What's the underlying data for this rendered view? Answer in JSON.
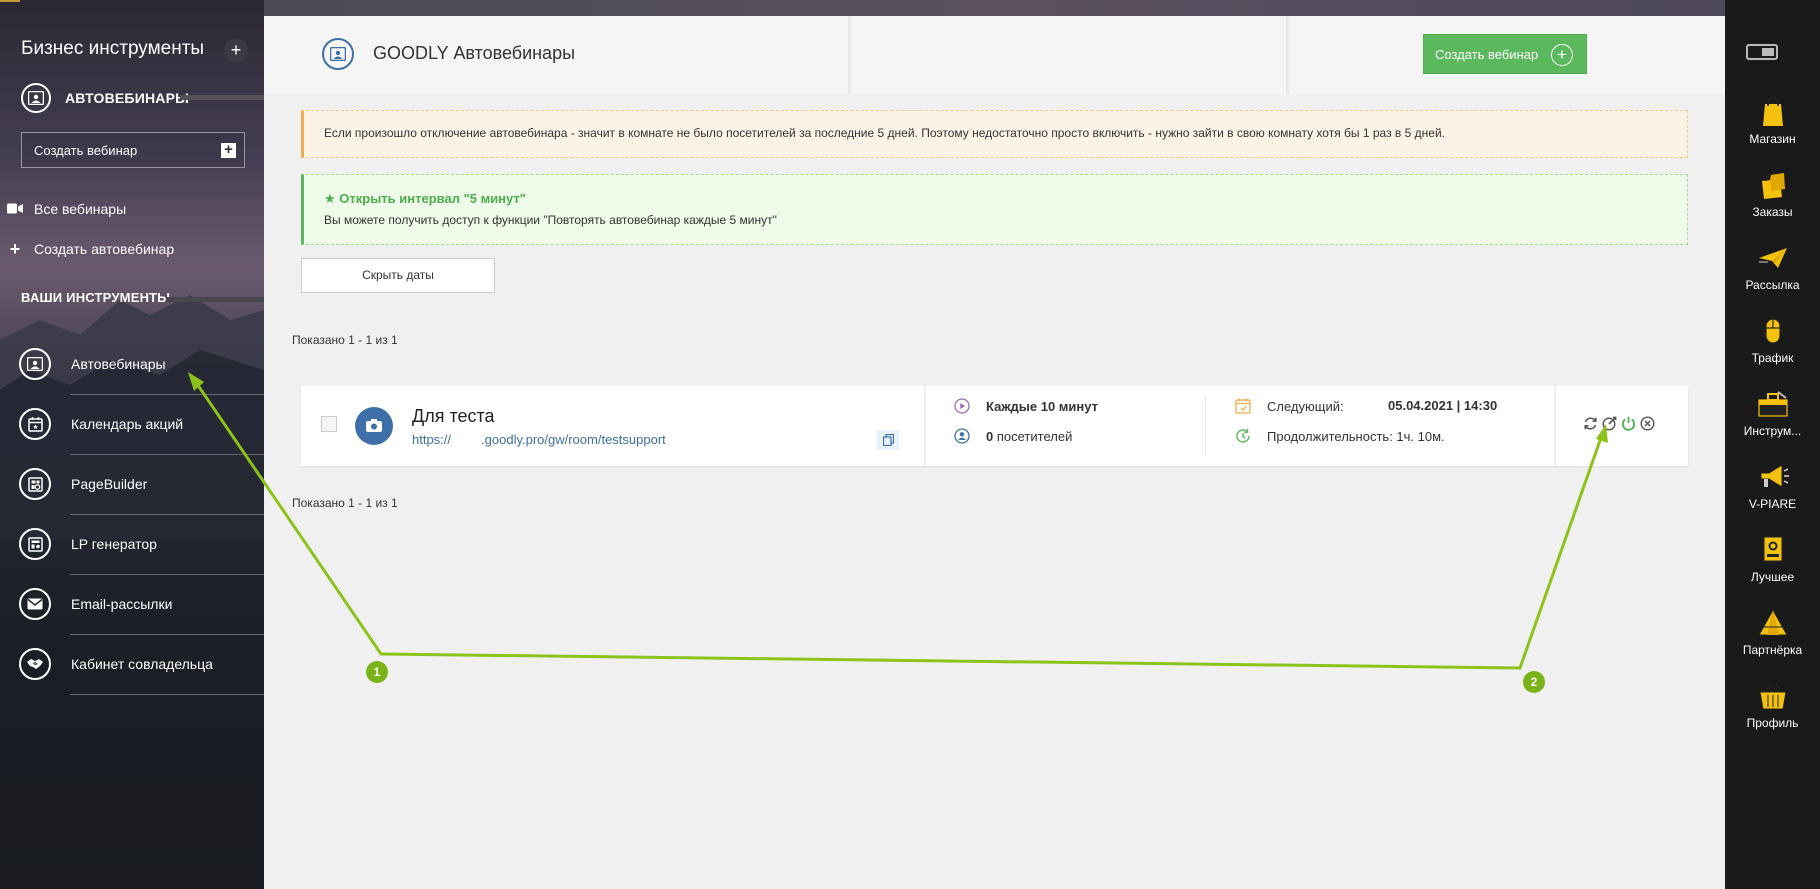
{
  "sidebar": {
    "title": "Бизнес инструменты",
    "section_label": "АВТОВЕБИНАРЫ",
    "create_webinar": "Создать вебинар",
    "links": [
      {
        "label": "Все вебинары",
        "icon": "video-icon"
      },
      {
        "label": "Создать автовебинар",
        "icon": "plus-icon"
      }
    ],
    "tools_label": "ВАШИ ИНСТРУМЕНТЫ",
    "tools": [
      {
        "label": "Автовебинары",
        "icon": "webinar-icon"
      },
      {
        "label": "Календарь акций",
        "icon": "calendar-icon"
      },
      {
        "label": "PageBuilder",
        "icon": "page-builder-icon"
      },
      {
        "label": "LP генератор",
        "icon": "lp-icon"
      },
      {
        "label": "Email-рассылки",
        "icon": "mail-icon"
      },
      {
        "label": "Кабинет совладельца",
        "icon": "handshake-icon"
      }
    ]
  },
  "header": {
    "title": "GOODLY Автовебинары",
    "create_button": "Создать вебинар"
  },
  "alerts": {
    "warning": "Если произошло отключение автовебинара - значит в комнате не было посетителей за последние 5 дней. Поэтому недостаточно просто включить - нужно зайти в свою комнату хотя бы 1 раз в 5 дней.",
    "promo_title": "★ Открыть интервал \"5 минут\"",
    "promo_text": "Вы можете получить доступ к функции \"Повторять автовебинар каждые 5 минут\""
  },
  "hide_dates_button": "Скрыть даты",
  "pagination_text": "Показано 1 - 1 из 1",
  "webinar": {
    "name": "Для теста",
    "url_prefix": "https://",
    "url_suffix": ".goodly.pro/gw/room/testsupport",
    "interval": "Каждые 10 минут",
    "visitors_count": "0",
    "visitors_label": "посетителей",
    "next_label": "Следующий:",
    "next_value": "05.04.2021 | 14:30",
    "duration": "Продолжительность: 1ч. 10м."
  },
  "rightbar": {
    "items": [
      {
        "label": "Магазин",
        "icon": "shopping-bag-icon"
      },
      {
        "label": "Заказы",
        "icon": "orders-icon"
      },
      {
        "label": "Рассылка",
        "icon": "paper-plane-icon"
      },
      {
        "label": "Трафик",
        "icon": "mouse-icon"
      },
      {
        "label": "Инструм...",
        "icon": "toolbox-icon"
      },
      {
        "label": "V-PIARE",
        "icon": "megaphone-icon"
      },
      {
        "label": "Лучшее",
        "icon": "trophy-icon"
      },
      {
        "label": "Партнёрка",
        "icon": "pyramid-icon"
      },
      {
        "label": "Профиль",
        "icon": "basket-icon"
      }
    ]
  },
  "annotations": [
    "1",
    "2"
  ],
  "colors": {
    "accent_green": "#5cb85c",
    "brand_blue": "#3e6fa8",
    "annotation_green": "#7ab317"
  }
}
